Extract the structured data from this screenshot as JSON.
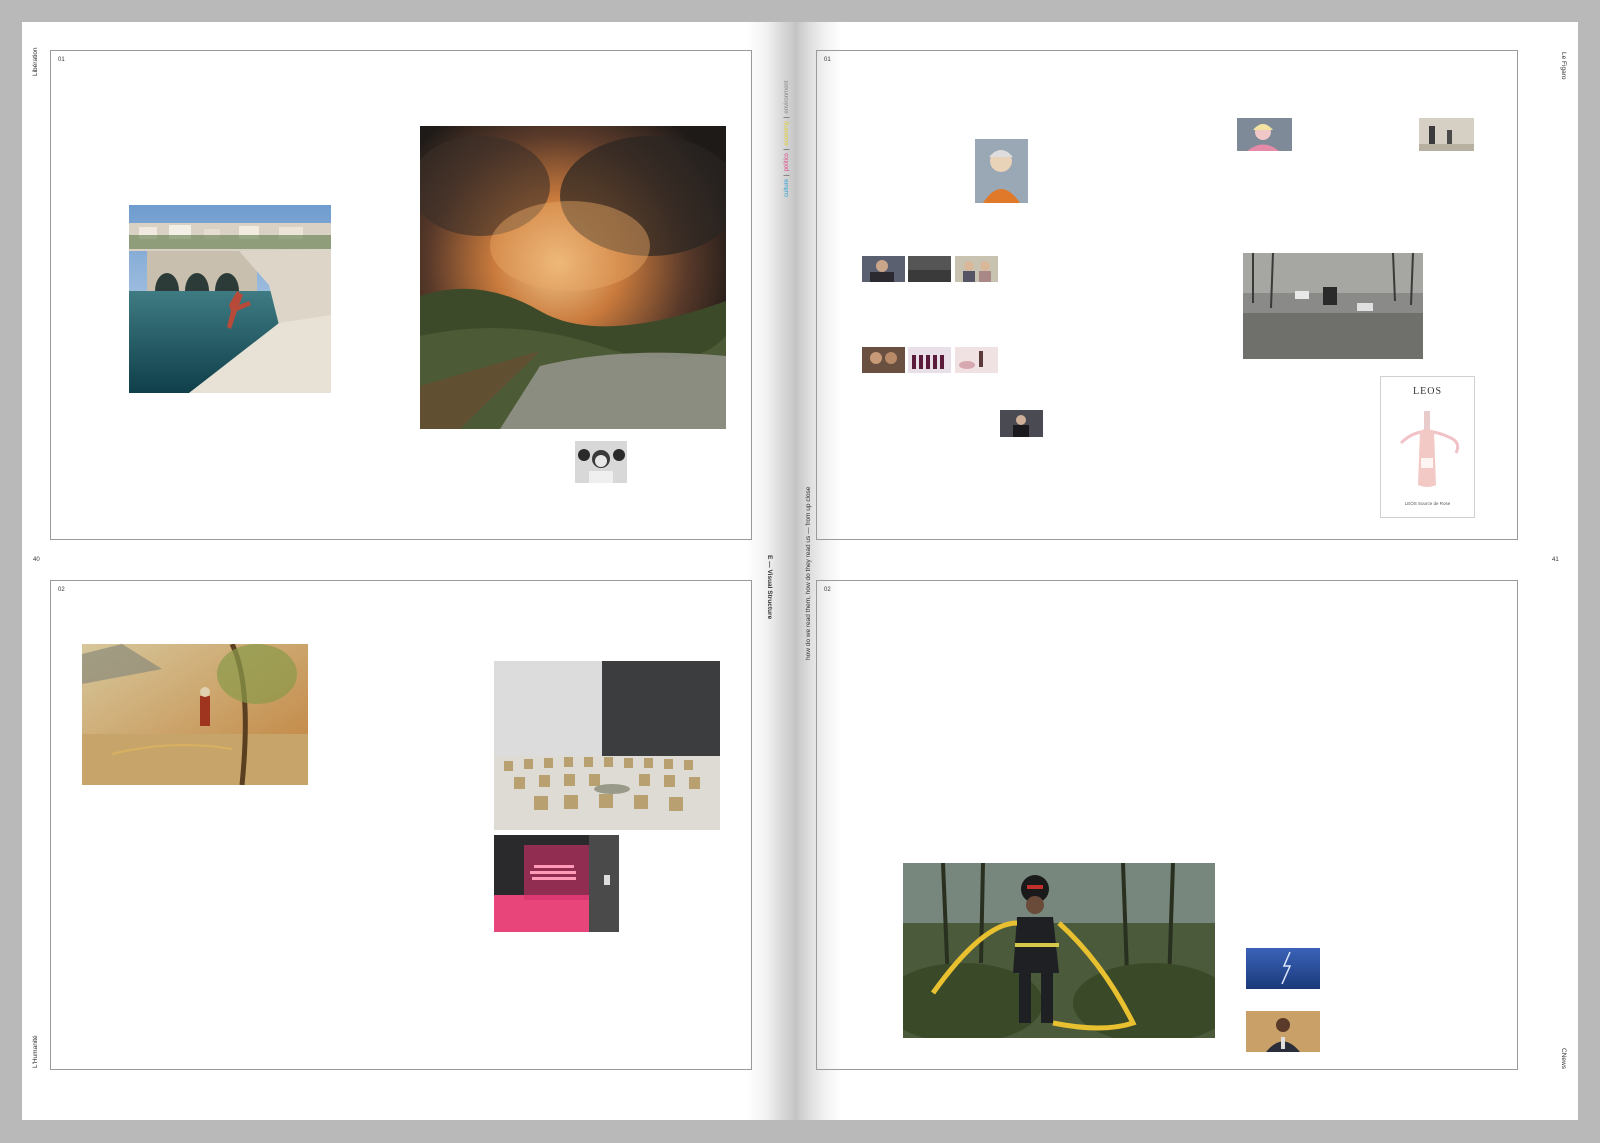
{
  "left_page": {
    "top_label": "Libération",
    "bottom_label": "L'Humanité",
    "page_number": "40",
    "top_quadrant_number": "01",
    "bottom_quadrant_number": "02"
  },
  "right_page": {
    "top_label": "Le Figaro",
    "bottom_label": "CNews",
    "page_number": "41",
    "top_quadrant_number": "01",
    "bottom_quadrant_number": "02"
  },
  "gutter": {
    "section_title": "E — Visual Structure",
    "subtitle": "how do we read them, how do they read us — from up close"
  },
  "legend": {
    "items": [
      {
        "label": "culture",
        "color": "#2aa3d8"
      },
      {
        "label": "politics",
        "color": "#e04a8a"
      },
      {
        "label": "economy",
        "color": "#e0cc2a"
      },
      {
        "label": "environment",
        "color": "#8a8a8a"
      }
    ]
  },
  "ad": {
    "brand": "LEOS",
    "product": "LEOS Source de Rose"
  }
}
